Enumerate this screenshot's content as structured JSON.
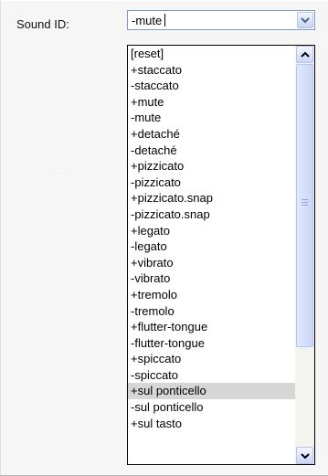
{
  "form": {
    "sound_id_label": "Sound ID:",
    "sound_id_value": "-mute"
  },
  "dropdown": {
    "items": [
      "[reset]",
      "+staccato",
      "-staccato",
      "+mute",
      "-mute",
      "+detaché",
      "-detaché",
      "+pizzicato",
      "-pizzicato",
      "+pizzicato.snap",
      "-pizzicato.snap",
      "+legato",
      "-legato",
      "+vibrato",
      "-vibrato",
      "+tremolo",
      "-tremolo",
      "+flutter-tongue",
      "-flutter-tongue",
      "+spiccato",
      "-spiccato",
      "+sul ponticello",
      "-sul ponticello",
      "+sul tasto"
    ],
    "highlighted_item": "+sul ponticello",
    "scroll_position_fraction": 0.0
  },
  "icons": {
    "combo_arrow": "chevron-down-icon",
    "scroll_up": "chevron-up-icon",
    "scroll_down": "chevron-down-icon",
    "scroll_grip": "grip-icon"
  },
  "colors": {
    "highlight": "#d6d6d6",
    "input_border": "#7f9db9"
  }
}
